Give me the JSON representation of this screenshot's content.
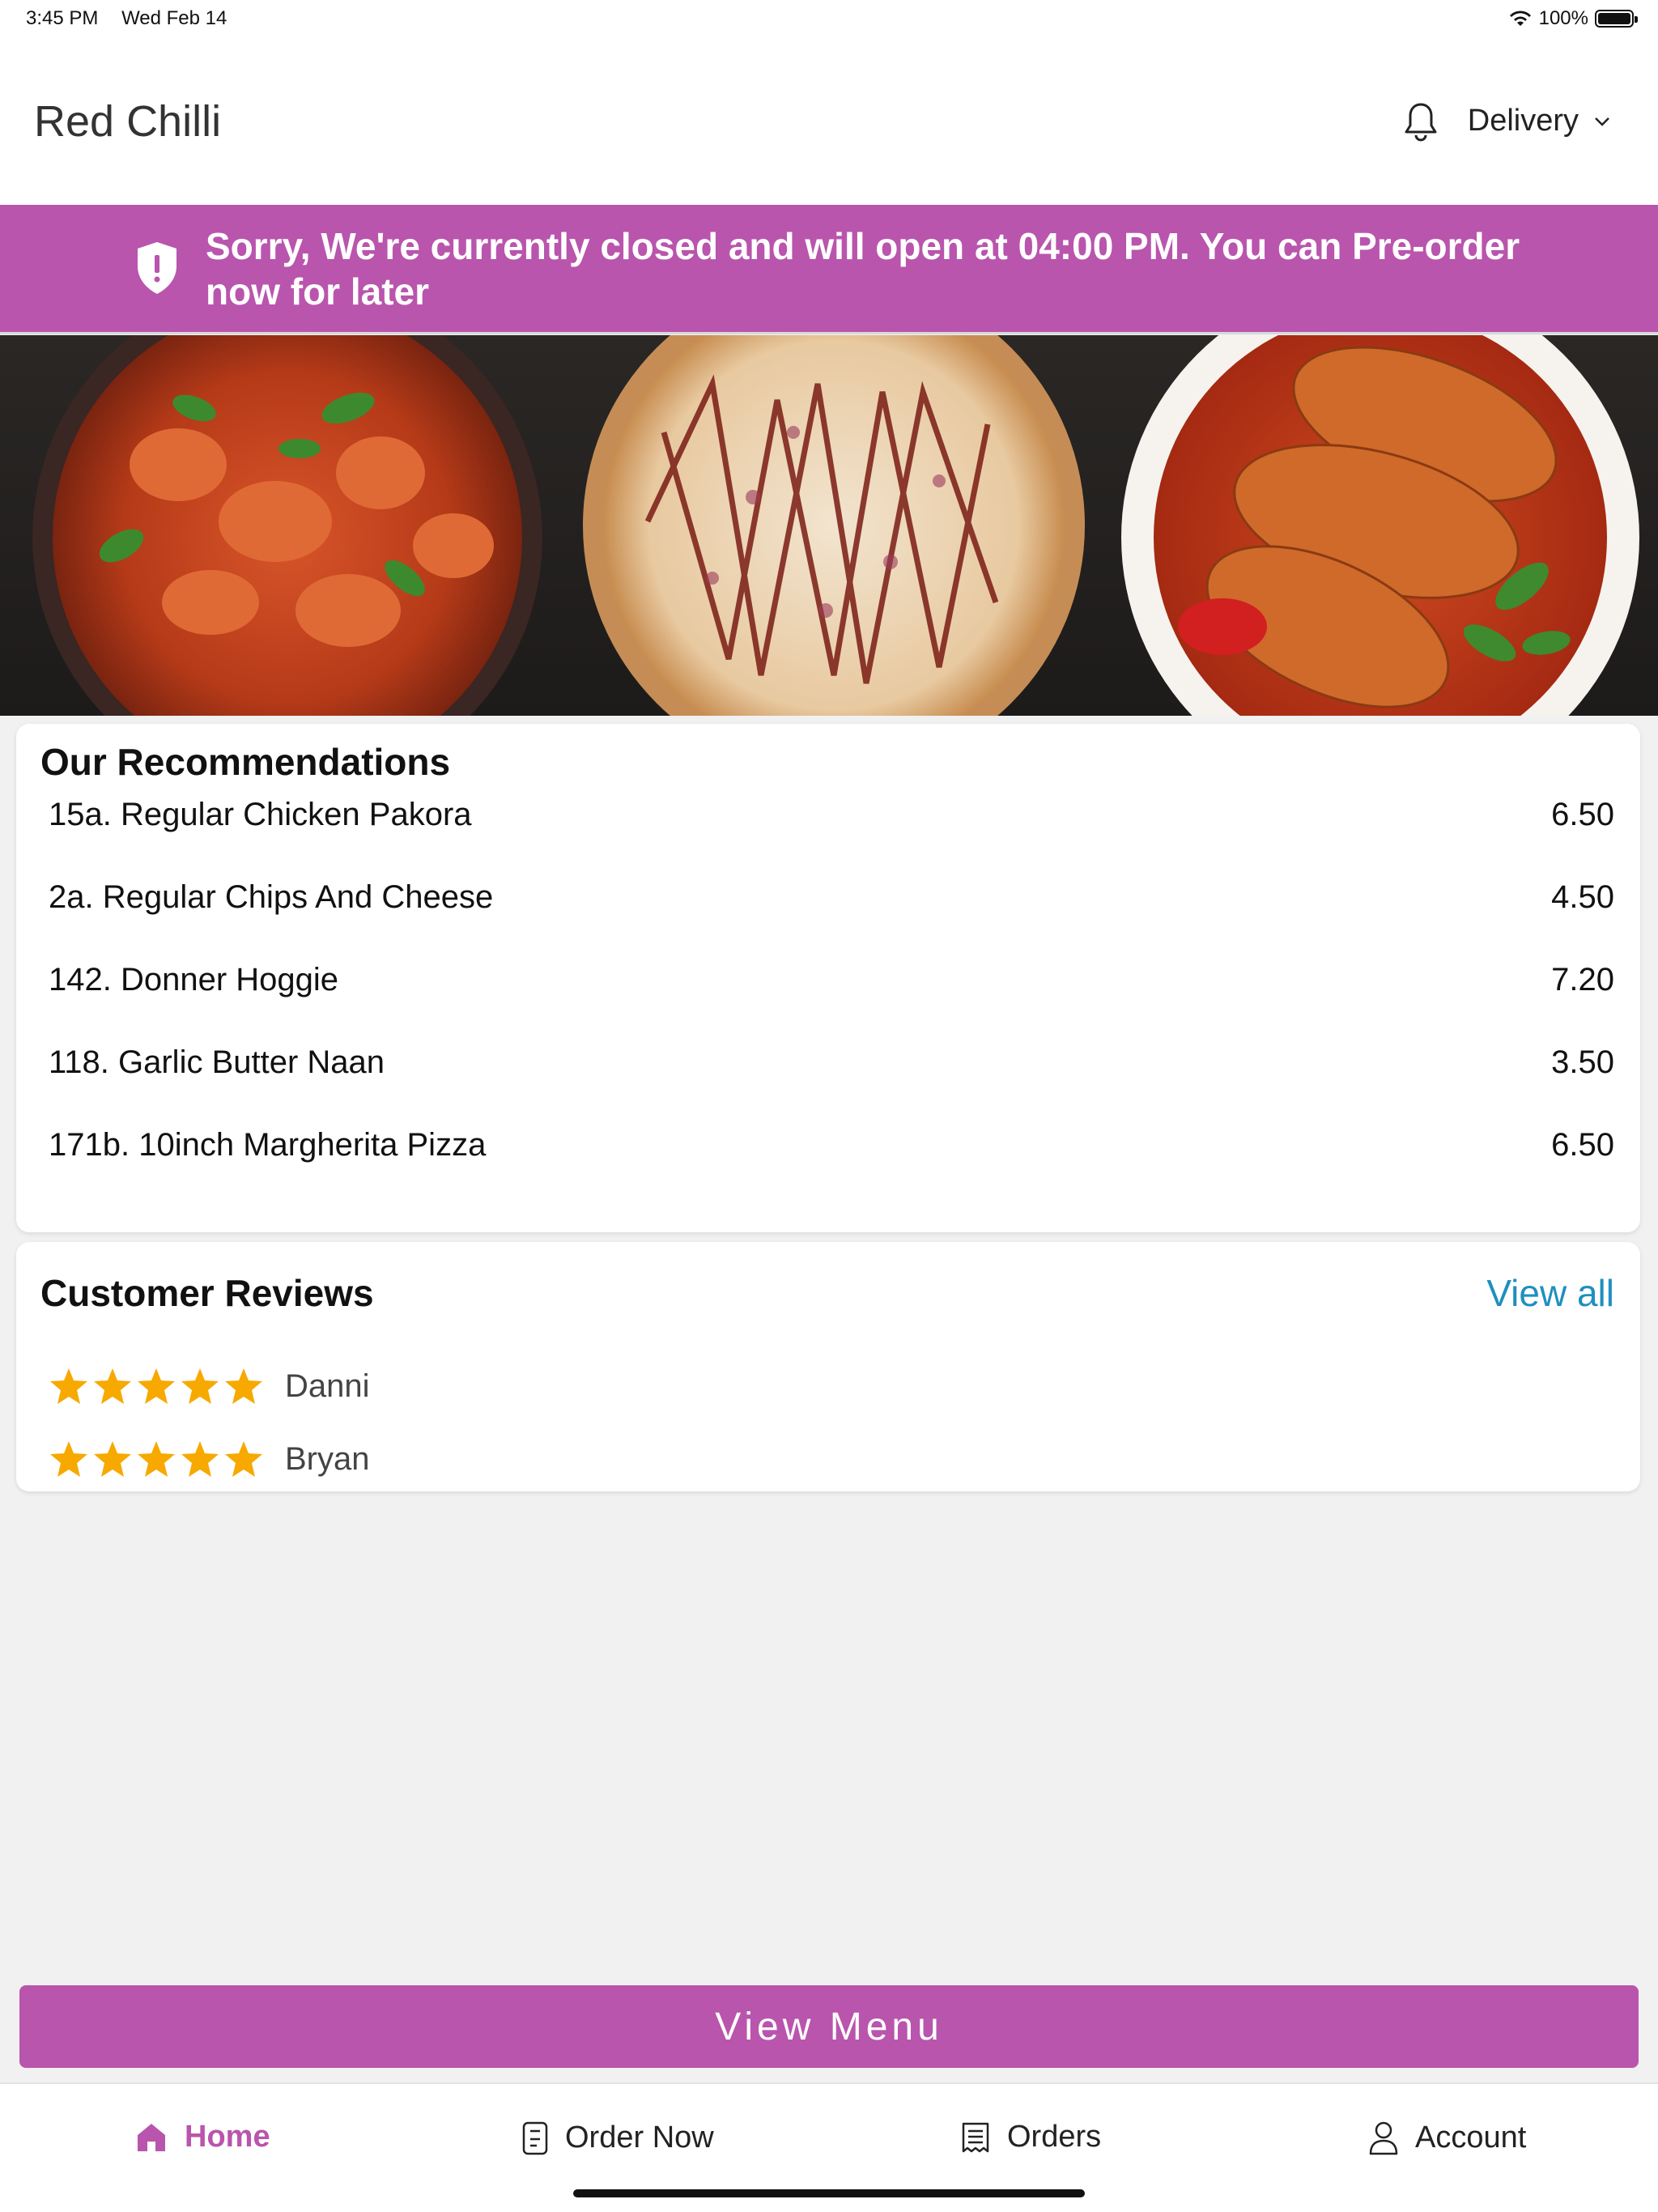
{
  "status_bar": {
    "time": "3:45 PM",
    "date": "Wed Feb 14",
    "battery": "100%"
  },
  "header": {
    "title": "Red Chilli",
    "mode": "Delivery"
  },
  "banner": {
    "text": "Sorry, We're currently closed and will open at 04:00 PM. You can Pre-order now for later"
  },
  "recommendations": {
    "title": "Our Recommendations",
    "items": [
      {
        "name": "15a. Regular Chicken Pakora",
        "price": "6.50"
      },
      {
        "name": "2a. Regular Chips And Cheese",
        "price": "4.50"
      },
      {
        "name": "142. Donner Hoggie",
        "price": "7.20"
      },
      {
        "name": "118. Garlic Butter Naan",
        "price": "3.50"
      },
      {
        "name": "171b. 10inch Margherita Pizza",
        "price": "6.50"
      }
    ]
  },
  "reviews": {
    "title": "Customer Reviews",
    "view_all": "View all",
    "items": [
      {
        "name": "Danni",
        "rating": 5
      },
      {
        "name": "Bryan",
        "rating": 5
      }
    ]
  },
  "view_menu_label": "View Menu",
  "nav": {
    "home": "Home",
    "order_now": "Order Now",
    "orders": "Orders",
    "account": "Account"
  },
  "colors": {
    "brand": "#b955ad",
    "link": "#1f8fbf",
    "star": "#f7a900"
  }
}
